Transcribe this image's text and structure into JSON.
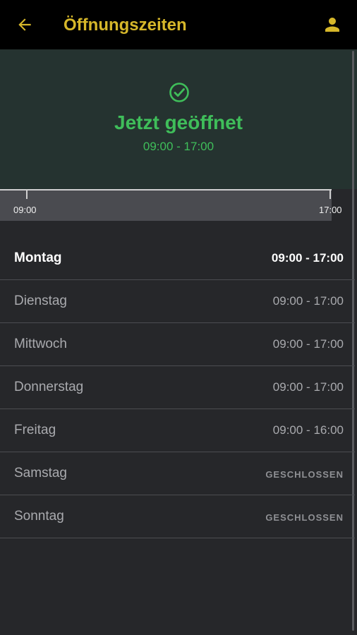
{
  "header": {
    "title": "Öffnungszeiten",
    "back_icon": "arrow-left-icon",
    "profile_icon": "person-icon",
    "accent": "#d6b72a"
  },
  "status": {
    "icon": "check-circle-icon",
    "text": "Jetzt geöffnet",
    "range": "09:00 - 17:00",
    "color": "#3fbe5a"
  },
  "timeline": {
    "start_label": "09:00",
    "end_label": "17:00"
  },
  "schedule": [
    {
      "day": "Montag",
      "hours": "09:00 - 17:00",
      "today": true
    },
    {
      "day": "Dienstag",
      "hours": "09:00 - 17:00"
    },
    {
      "day": "Mittwoch",
      "hours": "09:00 - 17:00"
    },
    {
      "day": "Donnerstag",
      "hours": "09:00 - 17:00"
    },
    {
      "day": "Freitag",
      "hours": "09:00 - 16:00"
    },
    {
      "day": "Samstag",
      "hours": "GESCHLOSSEN",
      "closed": true
    },
    {
      "day": "Sonntag",
      "hours": "GESCHLOSSEN",
      "closed": true
    }
  ]
}
